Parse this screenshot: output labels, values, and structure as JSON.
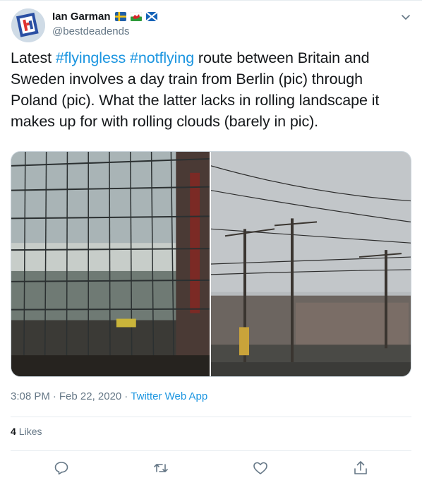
{
  "author": {
    "name": "Ian Garman",
    "handle": "@bestdeadends",
    "flags": [
      "sweden-flag",
      "wales-flag",
      "scotland-flag"
    ]
  },
  "tweet": {
    "text_1": "Latest ",
    "hashtag_1": "#flyingless",
    "text_2": " ",
    "hashtag_2": "#notflying",
    "text_3": " route between Britain and Sweden involves a day train from Berlin (pic) through Poland (pic). What the latter lacks in rolling landscape it makes up for with rolling clouds (barely in pic)."
  },
  "meta": {
    "time": "3:08 PM",
    "separator": "·",
    "date": "Feb 22, 2020",
    "separator2": "·",
    "source": "Twitter Web App"
  },
  "stats": {
    "likes_count": "4",
    "likes_label": "Likes"
  },
  "actions": [
    "reply-icon",
    "retweet-icon",
    "like-icon",
    "share-icon"
  ],
  "colors": {
    "link": "#1b95e0",
    "secondary_text": "#657786",
    "divider": "#e6ecf0"
  }
}
